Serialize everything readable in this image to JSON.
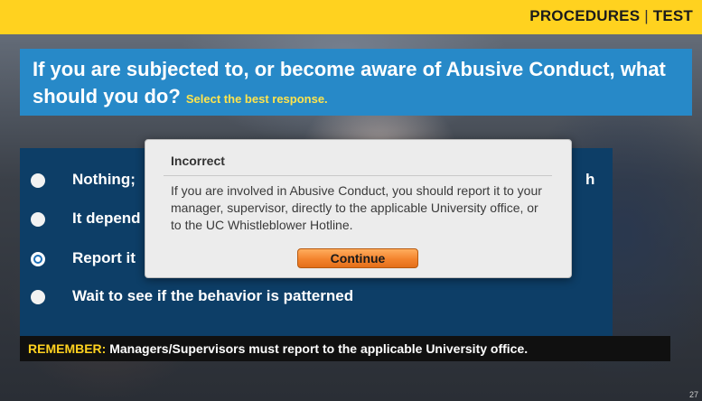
{
  "header": {
    "section": "PROCEDURES",
    "separator": "|",
    "mode": "TEST"
  },
  "question": {
    "text": "If you are subjected to, or become aware of Abusive Conduct, what should you do?",
    "hint": "Select the best response."
  },
  "options": [
    {
      "label": "Nothing;",
      "selected": false,
      "trailing_visible": "h"
    },
    {
      "label": "It depend",
      "selected": false
    },
    {
      "label": "Report it",
      "selected": true
    },
    {
      "label": "Wait to see if the behavior is patterned",
      "selected": false
    }
  ],
  "remember": {
    "key": "REMEMBER:",
    "text": "Managers/Supervisors must report to the applicable University office."
  },
  "dialog": {
    "title": "Incorrect",
    "body": "If you are involved in Abusive Conduct, you should report it to your manager, supervisor, directly to the applicable University office, or to the UC Whistleblower Hotline.",
    "button_label": "Continue"
  },
  "slide_number": "27",
  "colors": {
    "topbar": "#ffd21f",
    "question_box": "#2789c8",
    "options_box": "#0d3e67",
    "hint_text": "#ffe44d",
    "button_orange": "#f3832d"
  }
}
